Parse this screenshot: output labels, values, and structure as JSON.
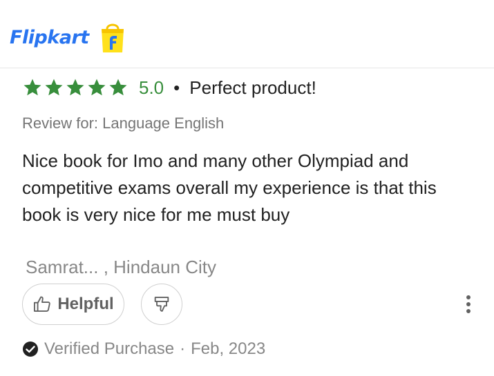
{
  "brand": {
    "name": "Flipkart",
    "color": "#2874f0",
    "logo_icon": "flipkart-bag-icon"
  },
  "review": {
    "rating": "5.0",
    "stars": 5,
    "star_color": "#388e3c",
    "separator": "•",
    "title": "Perfect product!",
    "review_for": "Review for: Language English",
    "body": "Nice book for Imo and many other Olympiad and competitive exams overall my experience is that this book is very nice for me must buy",
    "reviewer": "Samrat... , Hindaun City"
  },
  "actions": {
    "helpful_label": "Helpful",
    "helpful_icon": "thumbs-up-icon",
    "dislike_icon": "thumbs-down-icon",
    "more_icon": "more-vertical-icon"
  },
  "verification": {
    "icon": "check-circle-icon",
    "label": "Verified Purchase",
    "separator": "·",
    "date": "Feb, 2023"
  }
}
